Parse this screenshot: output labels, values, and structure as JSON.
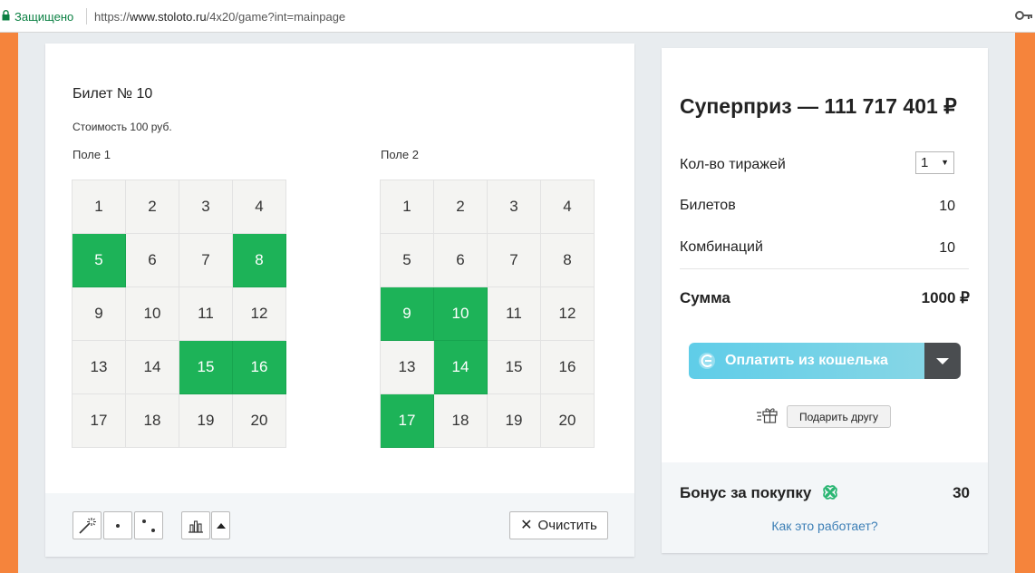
{
  "browser": {
    "secure_label": "Защищено",
    "url_scheme": "https://",
    "url_host": "www.stoloto.ru",
    "url_path": "/4x20/game?int=mainpage"
  },
  "ticket": {
    "title": "Билет № 10",
    "cost": "Стоимость 100 руб.",
    "fields": [
      {
        "label": "Поле 1",
        "numbers": [
          "1",
          "2",
          "3",
          "4",
          "5",
          "6",
          "7",
          "8",
          "9",
          "10",
          "11",
          "12",
          "13",
          "14",
          "15",
          "16",
          "17",
          "18",
          "19",
          "20"
        ],
        "selected": [
          "5",
          "8",
          "15",
          "16"
        ]
      },
      {
        "label": "Поле 2",
        "numbers": [
          "1",
          "2",
          "3",
          "4",
          "5",
          "6",
          "7",
          "8",
          "9",
          "10",
          "11",
          "12",
          "13",
          "14",
          "15",
          "16",
          "17",
          "18",
          "19",
          "20"
        ],
        "selected": [
          "9",
          "10",
          "14",
          "17"
        ]
      }
    ],
    "toolbar": {
      "tools": [
        "magic-wand-icon",
        "one-dot-icon",
        "two-dots-icon",
        "bar-chart-icon",
        "arrow-up-icon"
      ],
      "clear_label": "Очистить"
    }
  },
  "summary": {
    "prize": "Суперприз — 111 717 401 ₽",
    "draws_label": "Кол-во тиражей",
    "draws_value": "1",
    "tickets_label": "Билетов",
    "tickets_value": "10",
    "combos_label": "Комбинаций",
    "combos_value": "10",
    "total_label": "Сумма",
    "total_value": "1000 ₽",
    "pay_label": "Оплатить из кошелька",
    "gift_label": "Подарить другу",
    "bonus_label": "Бонус за покупку",
    "bonus_value": "30",
    "how_link": "Как это работает?"
  },
  "colors": {
    "selected_cell": "#1db358",
    "orange_edge": "#f5843c",
    "pay_button": "#5fcde8",
    "link": "#3c7fb6"
  }
}
